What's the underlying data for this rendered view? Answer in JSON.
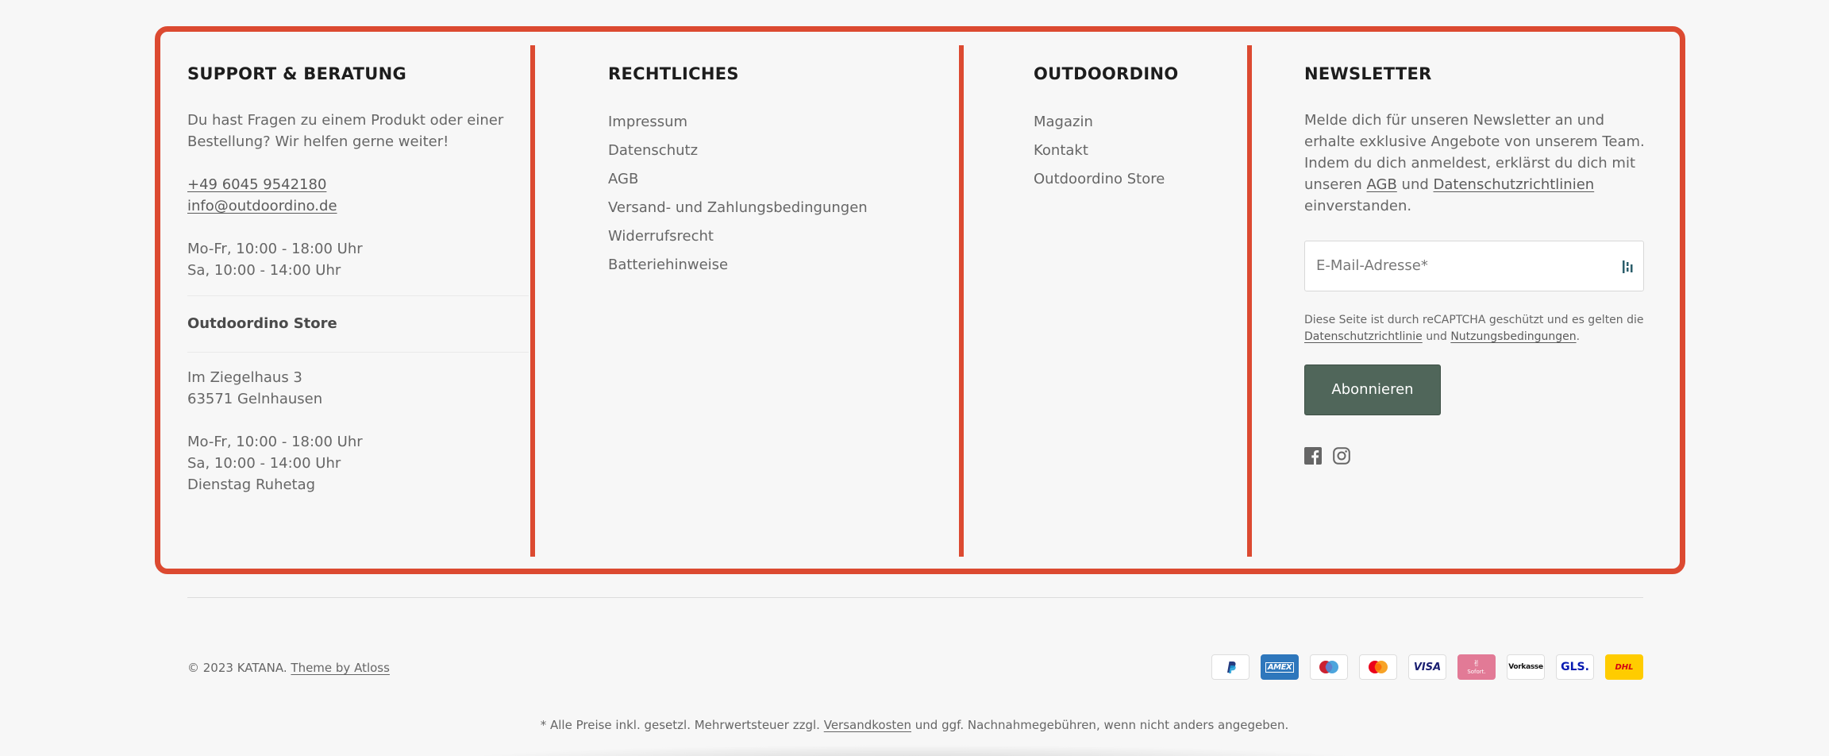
{
  "support": {
    "heading": "SUPPORT & BERATUNG",
    "intro": "Du hast Fragen zu einem Produkt oder einer Bestellung? Wir helfen gerne weiter!",
    "phone": "+49 6045 9542180",
    "email": "info@outdoordino.de",
    "hours_1": "Mo-Fr, 10:00 - 18:00 Uhr",
    "hours_2": "Sa, 10:00 - 14:00 Uhr",
    "store_title": "Outdoordino Store",
    "street": "Im Ziegelhaus 3",
    "city": "63571 Gelnhausen",
    "store_hours_1": "Mo-Fr, 10:00 - 18:00 Uhr",
    "store_hours_2": "Sa, 10:00 - 14:00 Uhr",
    "store_hours_3": "Dienstag Ruhetag"
  },
  "legal": {
    "heading": "RECHTLICHES",
    "links": [
      "Impressum",
      "Datenschutz",
      "AGB",
      "Versand- und Zahlungsbedingungen",
      "Widerrufsrecht",
      "Batteriehinweise"
    ]
  },
  "outdoordino": {
    "heading": "OUTDOORDINO",
    "links": [
      "Magazin",
      "Kontakt",
      "Outdoordino Store"
    ]
  },
  "newsletter": {
    "heading": "NEWSLETTER",
    "text_1": "Melde dich für unseren Newsletter an und erhalte exklusive Angebote von unserem Team. Indem du dich anmeldest, erklärst du dich mit unseren",
    "agb_link": "AGB",
    "text_2": "und",
    "privacy_link": "Datenschutzrichtlinien",
    "text_3": "einverstanden.",
    "email_placeholder": "E-Mail-Adresse*",
    "captcha_1": "Diese Seite ist durch reCAPTCHA geschützt und es gelten die",
    "captcha_privacy": "Datenschutzrichtlinie",
    "captcha_and": "und",
    "captcha_terms": "Nutzungsbedingungen",
    "captcha_end": ".",
    "button": "Abonnieren",
    "social_icons": [
      "facebook-icon",
      "instagram-icon"
    ]
  },
  "bottom": {
    "copyright": "© 2023 KATANA.",
    "theme_link": "Theme by Atloss",
    "payments": [
      "PayPal",
      "AMEX",
      "Maestro",
      "Mastercard",
      "VISA",
      "Sofort.",
      "Vorkasse",
      "GLS.",
      "DHL"
    ],
    "footnote_1": "* Alle Preise inkl. gesetzl. Mehrwertsteuer zzgl.",
    "footnote_link": "Versandkosten",
    "footnote_2": "und ggf. Nachnahmegebühren, wenn nicht anders angegeben."
  },
  "colors": {
    "highlight": "#dc4a31",
    "button": "#50665a",
    "amex": "#2e77bc",
    "sofort": "#e27a96",
    "dhl": "#ffcc00"
  }
}
